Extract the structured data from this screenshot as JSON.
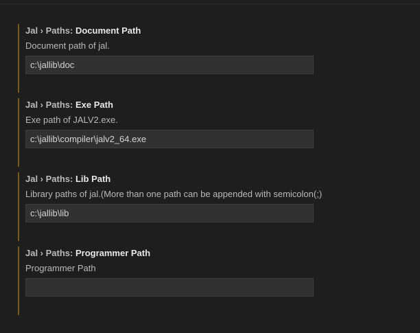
{
  "settings": [
    {
      "category": "Jal › Paths: ",
      "name": "Document Path",
      "description": "Document path of jal.",
      "value": "c:\\jallib\\doc"
    },
    {
      "category": "Jal › Paths: ",
      "name": "Exe Path",
      "description": "Exe path of JALV2.exe.",
      "value": "c:\\jallib\\compiler\\jalv2_64.exe"
    },
    {
      "category": "Jal › Paths: ",
      "name": "Lib Path",
      "description": "Library paths of jal.(More than one path can be appended with semicolon(;)",
      "value": "c:\\jallib\\lib"
    },
    {
      "category": "Jal › Paths: ",
      "name": "Programmer Path",
      "description": "Programmer Path",
      "value": ""
    }
  ],
  "colors": {
    "background": "#1e1e1e",
    "accent_bar": "#7a5a1a",
    "input_background": "#313131"
  }
}
